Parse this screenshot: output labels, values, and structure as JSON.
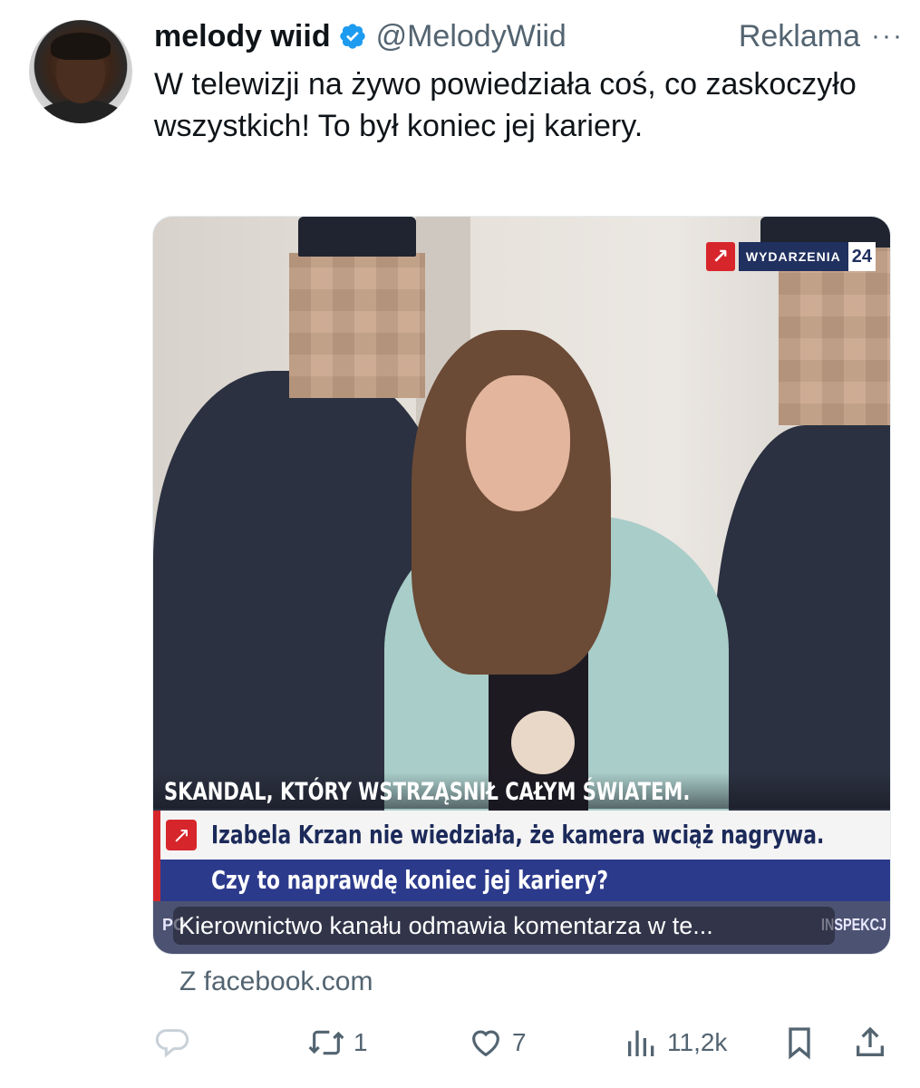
{
  "author": {
    "display_name": "melody wiid",
    "handle": "@MelodyWiid",
    "verified_icon": "verified-badge-icon"
  },
  "header": {
    "ad_label": "Reklama",
    "more_label": "···"
  },
  "tweet": {
    "text": "W telewizji na żywo powiedziała coś, co zaskoczyło wszystkich! To był koniec jej kariery."
  },
  "media": {
    "channel_logo": {
      "word": "WYDARZENIA",
      "number": "24"
    },
    "headline_top": "SKANDAL, KTÓRY WSTRZĄSNIŁ CAŁYM ŚWIATEM.",
    "headline_mid": "Izabela Krzan nie wiedziała, że kamera wciąż nagrywa.",
    "headline_bottom": "Czy to naprawdę koniec jej kariery?",
    "ticker_left": "PO",
    "ticker_right": "INSPEKCJ",
    "caption": "Kierownictwo kanału odmawia komentarza w te..."
  },
  "source_label": "Z facebook.com",
  "actions": {
    "reply": {
      "icon": "reply-icon",
      "count": ""
    },
    "retweet": {
      "icon": "retweet-icon",
      "count": "1"
    },
    "like": {
      "icon": "heart-icon",
      "count": "7"
    },
    "views": {
      "icon": "views-icon",
      "count": "11,2k"
    },
    "bookmark": {
      "icon": "bookmark-icon"
    },
    "share": {
      "icon": "share-icon"
    }
  },
  "colors": {
    "text": "#0f1419",
    "secondary": "#536471",
    "verified": "#1d9bf0",
    "news_red": "#d7262b",
    "news_blue": "#2c3a8c"
  }
}
